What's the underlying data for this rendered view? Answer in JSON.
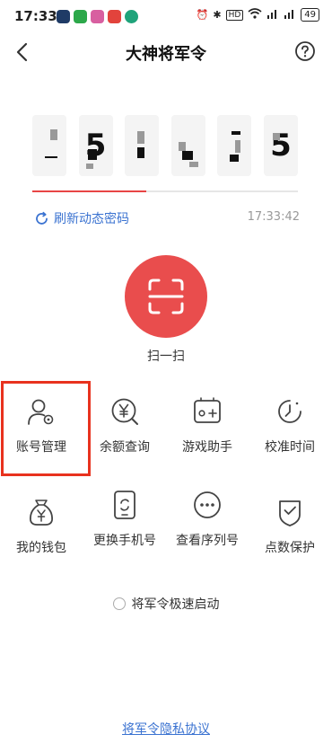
{
  "status_bar": {
    "time": "17:33",
    "network_badge": "HD",
    "battery": "49"
  },
  "nav": {
    "title": "大神将军令"
  },
  "token": {
    "digits": [
      "",
      "5",
      "",
      "",
      "",
      "5"
    ],
    "progress": 0.43,
    "refresh_label": "刷新动态密码",
    "time": "17:33:42"
  },
  "scan": {
    "label": "扫一扫"
  },
  "grid": [
    {
      "label": "账号管理",
      "icon": "user-gear-icon"
    },
    {
      "label": "余额查询",
      "icon": "yen-search-icon"
    },
    {
      "label": "游戏助手",
      "icon": "gamepad-icon"
    },
    {
      "label": "校准时间",
      "icon": "clock-icon"
    },
    {
      "label": "我的钱包",
      "icon": "wallet-bag-icon"
    },
    {
      "label": "更换手机号",
      "icon": "phone-swap-icon"
    },
    {
      "label": "查看序列号",
      "icon": "more-dots-icon"
    },
    {
      "label": "点数保护",
      "icon": "shield-check-icon"
    }
  ],
  "fast_start": {
    "label": "将军令极速启动",
    "checked": false
  },
  "footer": {
    "privacy_label": "将军令隐私协议"
  },
  "colors": {
    "accent_red": "#e94d4d",
    "link_blue": "#3b73d1",
    "highlight": "#e8321e"
  }
}
